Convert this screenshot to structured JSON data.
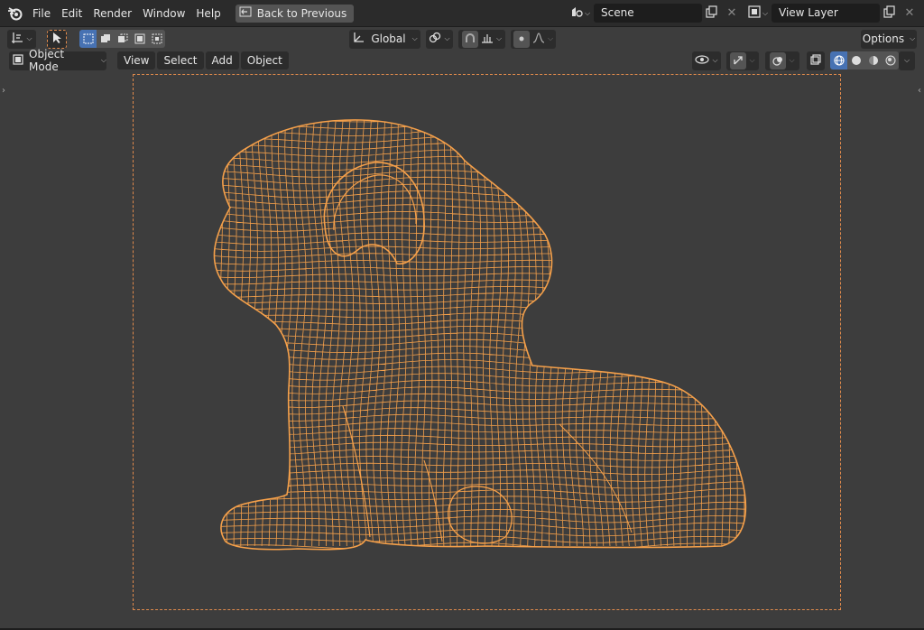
{
  "topbar": {
    "menu": [
      "File",
      "Edit",
      "Render",
      "Window",
      "Help"
    ],
    "back_label": "Back to Previous",
    "scene": "Scene",
    "view_layer": "View Layer"
  },
  "tool_header": {
    "transform_orientation": "Global",
    "options_label": "Options"
  },
  "view_header": {
    "mode": "Object Mode",
    "menus": [
      "View",
      "Select",
      "Add",
      "Object"
    ]
  },
  "colors": {
    "accent": "#4772b3",
    "wire": "#f5a04a",
    "viewport_bg": "#3d3d3d",
    "header_bg": "#2b2b2b"
  },
  "icons": [
    "blender-logo-icon",
    "back-icon",
    "scene-icon",
    "view-layer-icon",
    "copy-icon",
    "close-icon",
    "transform-icon",
    "cursor-select-icon",
    "orientation-icon",
    "pivot-icon",
    "snap-icon",
    "proportional-icon",
    "falloff-icon",
    "object-mode-icon",
    "visibility-icon",
    "gizmo-icon",
    "overlay-icon",
    "xray-icon",
    "wireframe-shading-icon",
    "solid-shading-icon",
    "material-shading-icon",
    "rendered-shading-icon"
  ]
}
